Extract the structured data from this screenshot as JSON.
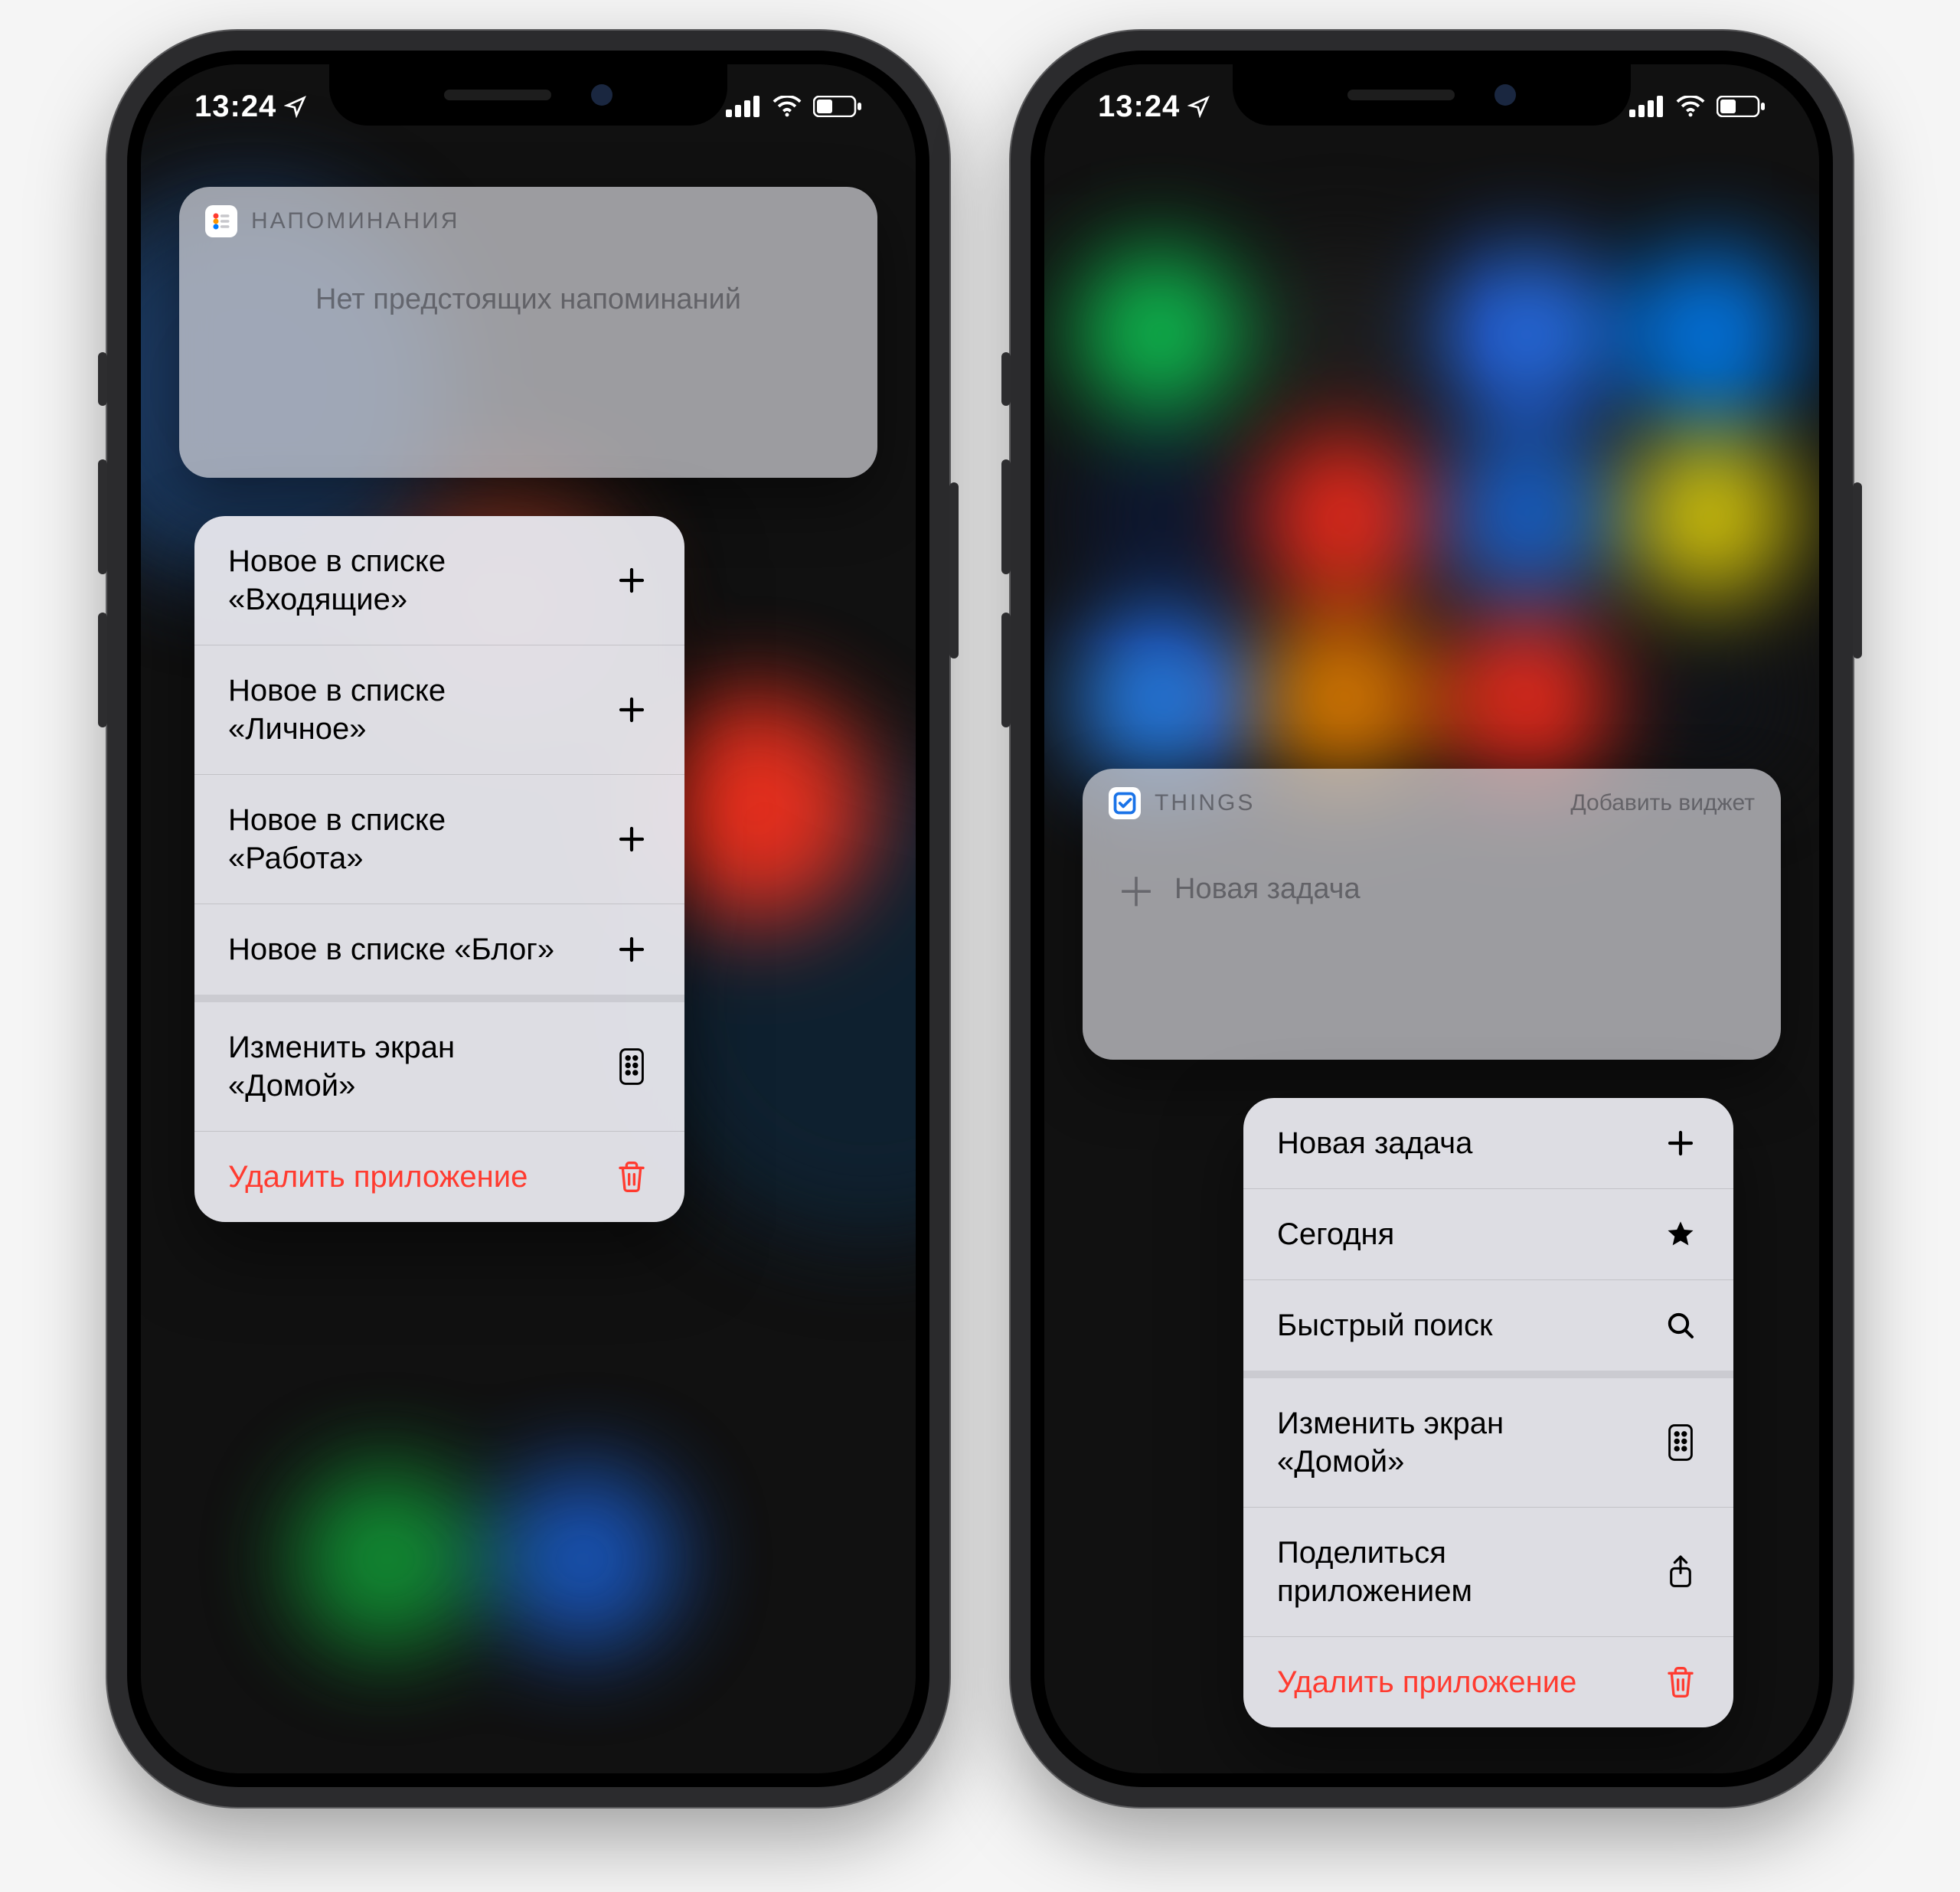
{
  "status": {
    "time": "13:24",
    "location_icon": "location-arrow"
  },
  "left": {
    "widget": {
      "app_name": "НАПОМИНАНИЯ",
      "body_text": "Нет предстоящих напоминаний"
    },
    "menu": {
      "items": [
        {
          "label": "Новое в списке «Входящие»",
          "icon": "plus"
        },
        {
          "label": "Новое в списке «Личное»",
          "icon": "plus"
        },
        {
          "label": "Новое в списке «Работа»",
          "icon": "plus"
        },
        {
          "label": "Новое в списке «Блог»",
          "icon": "plus"
        }
      ],
      "edit_home": {
        "label": "Изменить экран «Домой»",
        "icon": "apps-grid"
      },
      "delete_app": {
        "label": "Удалить приложение",
        "icon": "trash"
      }
    }
  },
  "right": {
    "widget": {
      "app_name": "THINGS",
      "add_widget_label": "Добавить виджет",
      "new_task_label": "Новая задача"
    },
    "menu": {
      "items": [
        {
          "label": "Новая задача",
          "icon": "plus"
        },
        {
          "label": "Сегодня",
          "icon": "star"
        },
        {
          "label": "Быстрый поиск",
          "icon": "search"
        }
      ],
      "edit_home": {
        "label": "Изменить экран «Домой»",
        "icon": "apps-grid"
      },
      "share_app": {
        "label": "Поделиться приложением",
        "icon": "share"
      },
      "delete_app": {
        "label": "Удалить приложение",
        "icon": "trash"
      }
    }
  },
  "colors": {
    "destructive": "#ff3b30",
    "things_blue": "#1a73e8"
  }
}
